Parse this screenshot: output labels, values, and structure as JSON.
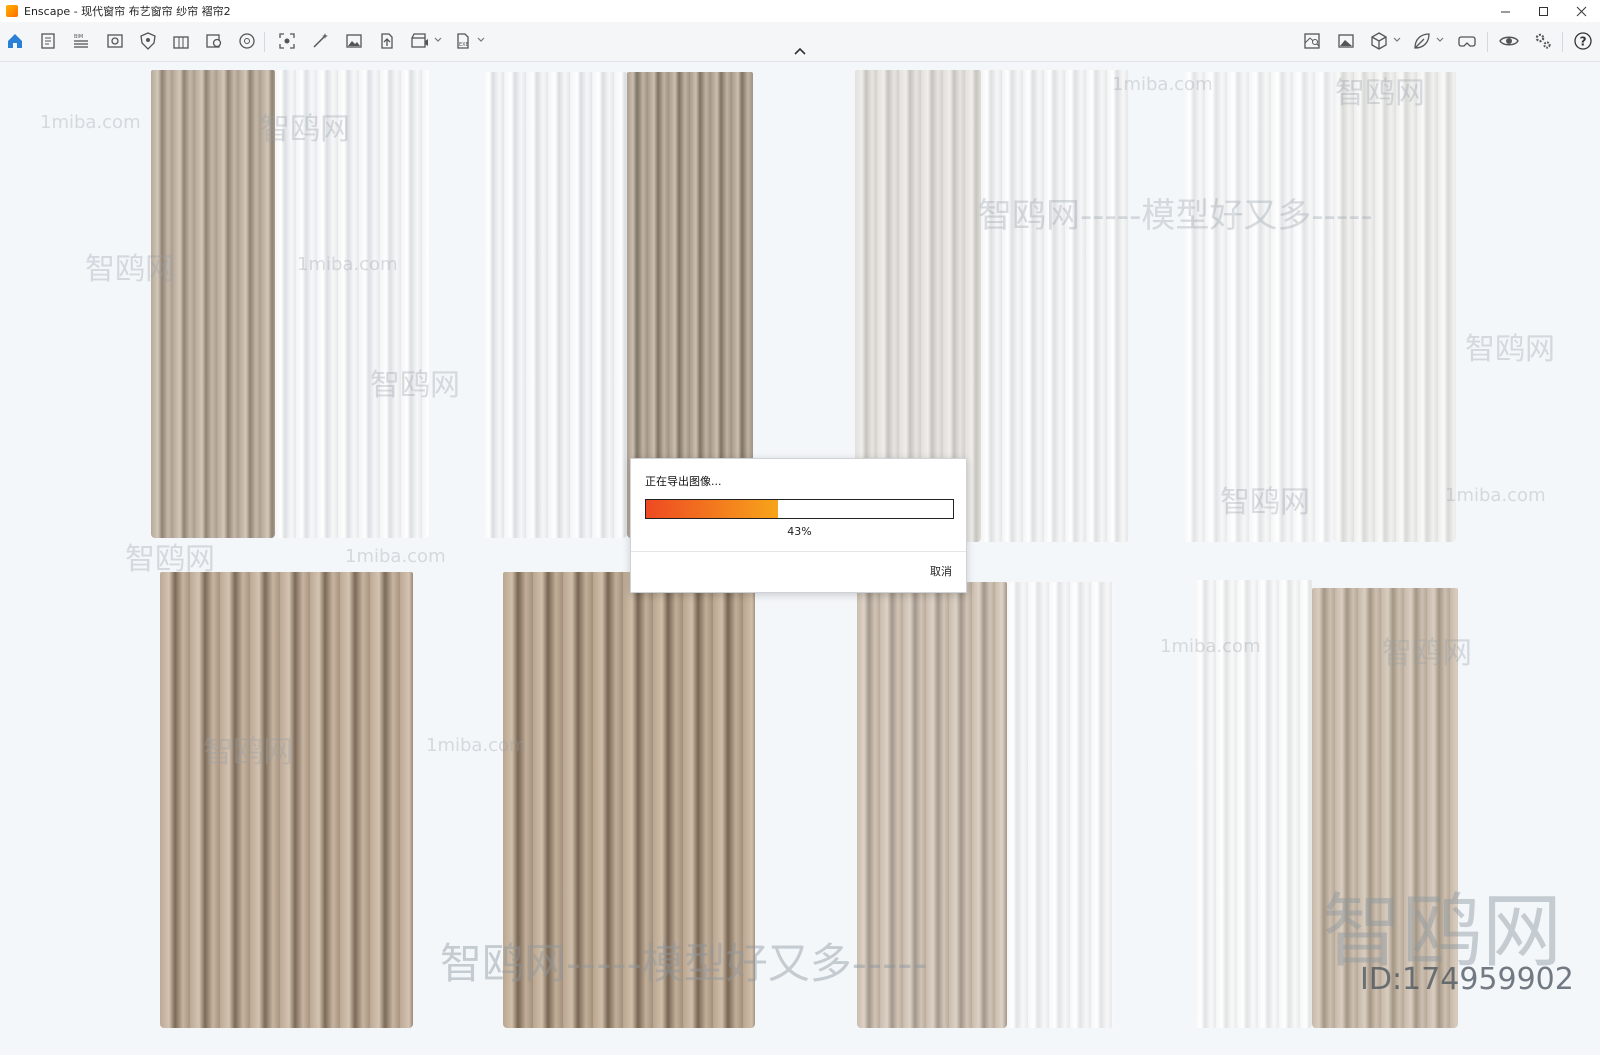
{
  "window": {
    "title": "Enscape - 现代窗帘 布艺窗帘 纱帘 褶帘2"
  },
  "toolbar": {
    "left_icons": [
      "home-icon",
      "document-icon",
      "bim-list-icon",
      "views-icon",
      "shield-icon",
      "building-icon",
      "asset-library-icon",
      "material-icon",
      "screenshot-icon",
      "magic-wand-icon",
      "image-gallery-icon",
      "upload-icon",
      "video-editor-icon",
      "export-icon"
    ],
    "right_icons": [
      "minimap-icon",
      "image-icon",
      "cube-icon",
      "leaf-icon",
      "vr-headset-icon",
      "eye-icon",
      "settings-icon",
      "help-icon"
    ]
  },
  "dialog": {
    "title": "正在导出图像...",
    "progress_percent": 43,
    "progress_label": "43%",
    "cancel_label": "取消",
    "colors": {
      "progress_start": "#ee4a22",
      "progress_end": "#f7a41a"
    }
  },
  "watermarks": {
    "site": "1miba.com",
    "brand": "智鸥网",
    "slogan": "智鸥网-----模型好又多-----",
    "big_logo": "智鸥网",
    "id_text": "ID:174959902"
  },
  "colors": {
    "viewport_bg": "#f4f7fa",
    "sheer_white": "#eef0f2",
    "taupe": "#b9aa9a",
    "beige": "#cbbfae",
    "light_gray": "#dcdad6"
  }
}
